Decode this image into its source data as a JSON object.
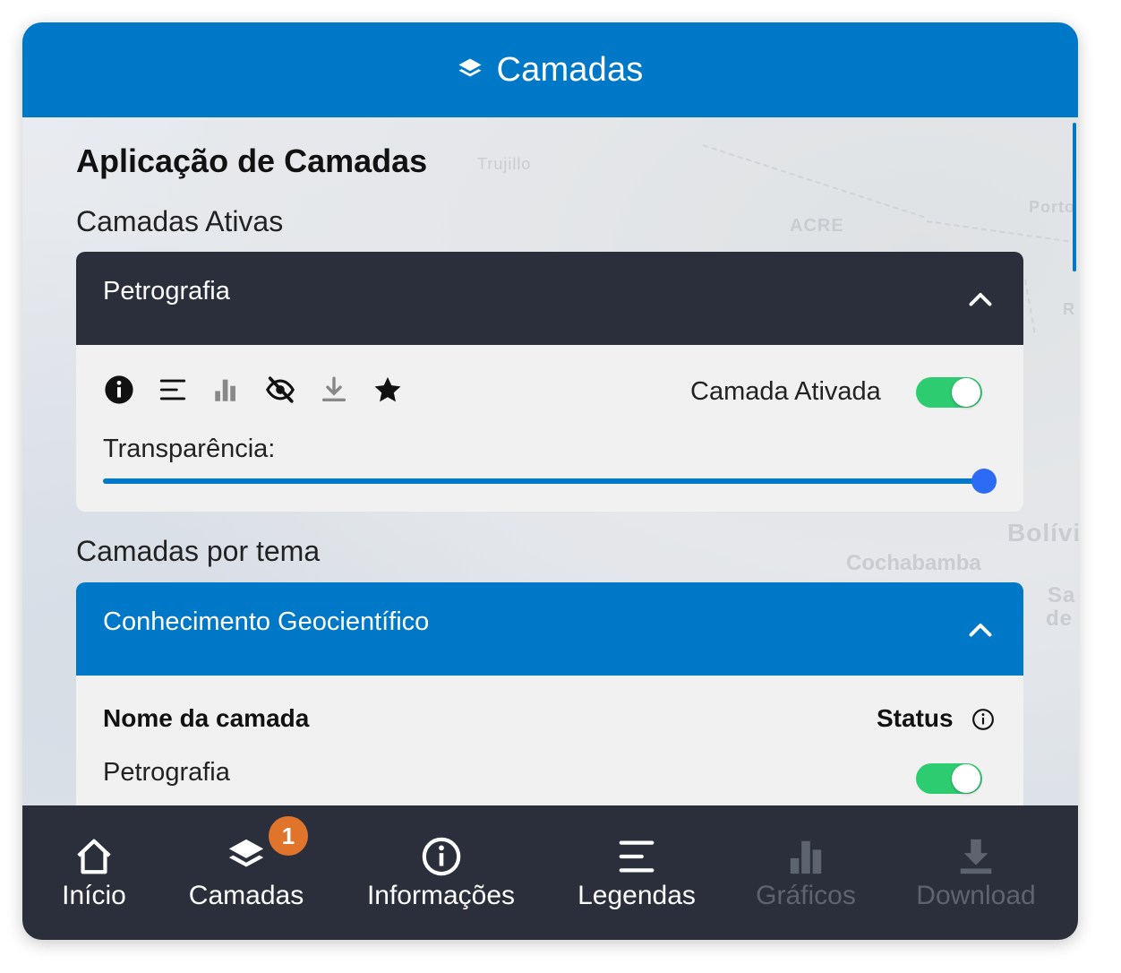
{
  "header": {
    "title": "Camadas",
    "icon": "layers-icon"
  },
  "map_labels": [
    "Trujillo",
    "ACRE",
    "Porto",
    "R",
    "Bolívi",
    "Cochabamba",
    "Sa",
    "de"
  ],
  "main": {
    "title": "Aplicação de Camadas",
    "active_section": "Camadas Ativas",
    "active_layer": {
      "name": "Petrografia",
      "tools": [
        "info-icon",
        "legend-icon",
        "chart-icon",
        "hide-icon",
        "download-icon",
        "favorite-icon"
      ],
      "toggle_label": "Camada Ativada",
      "toggle_on": true,
      "transparency_label": "Transparência:",
      "transparency_value": 1.0
    },
    "theme_section": "Camadas por tema",
    "theme": {
      "name": "Conhecimento Geocientífico",
      "col_name": "Nome da camada",
      "col_status": "Status",
      "rows": [
        {
          "name": "Petrografia",
          "on": true
        }
      ]
    }
  },
  "bottom_nav": {
    "items": [
      {
        "label": "Início",
        "icon": "home-icon",
        "enabled": true
      },
      {
        "label": "Camadas",
        "icon": "layers-icon",
        "enabled": true,
        "badge": "1"
      },
      {
        "label": "Informações",
        "icon": "info-icon",
        "enabled": true
      },
      {
        "label": "Legendas",
        "icon": "legend-icon",
        "enabled": true
      },
      {
        "label": "Gráficos",
        "icon": "chart-icon",
        "enabled": false
      },
      {
        "label": "Download",
        "icon": "download-icon",
        "enabled": false
      }
    ]
  },
  "colors": {
    "primary": "#0078c8",
    "dark": "#2a2f3b",
    "toggle_on": "#2ecc71",
    "badge": "#e1742b"
  }
}
